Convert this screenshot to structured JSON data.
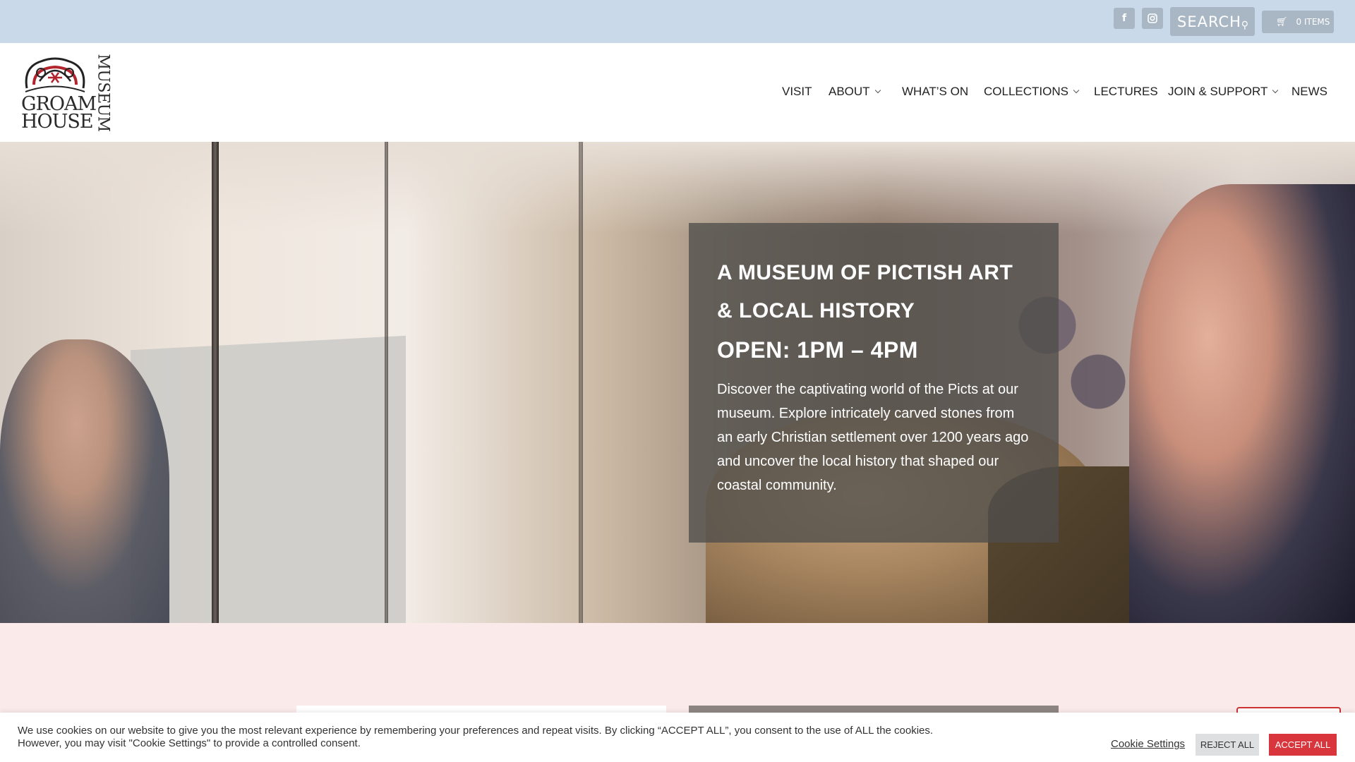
{
  "topbar": {
    "facebook_icon": "facebook-icon",
    "instagram_icon": "instagram-icon",
    "search_label": "SEARCH",
    "cart_label": "0 ITEMS"
  },
  "header": {
    "logo": {
      "line1": "GROAM",
      "line2": "HOUSE",
      "side": "MUSEUM"
    },
    "nav": [
      {
        "label": "VISIT",
        "has_dropdown": false
      },
      {
        "label": "ABOUT",
        "has_dropdown": true
      },
      {
        "label": "WHAT’S ON",
        "has_dropdown": false
      },
      {
        "label": "COLLECTIONS",
        "has_dropdown": true
      },
      {
        "label": "LECTURES",
        "has_dropdown": false
      },
      {
        "label": "JOIN & SUPPORT",
        "has_dropdown": true
      },
      {
        "label": "NEWS",
        "has_dropdown": false
      }
    ]
  },
  "hero": {
    "title": "A MUSEUM OF PICTISH ART & LOCAL HISTORY",
    "open_hours": "OPEN: 1PM – 4PM",
    "description": "Discover the captivating world of the Picts at our museum. Explore intricately carved stones from an early Christian settlement over 1200 years ago and uncover the local history that shaped our coastal community."
  },
  "cookie_bar": {
    "message": "We use cookies on our website to give you the most relevant experience by remembering your preferences and repeat visits. By clicking “ACCEPT ALL”, you consent to the use of ALL the cookies. However, you may visit \"Cookie Settings\" to provide a controlled consent.",
    "settings_label": "Cookie Settings",
    "reject_label": "REJECT ALL",
    "accept_label": "ACCEPT ALL"
  },
  "colors": {
    "topbar_bg": "#c9d9e9",
    "social_bg": "#a9b6c3",
    "page_bg": "#fbeaea",
    "accept_red": "#d8363c"
  }
}
